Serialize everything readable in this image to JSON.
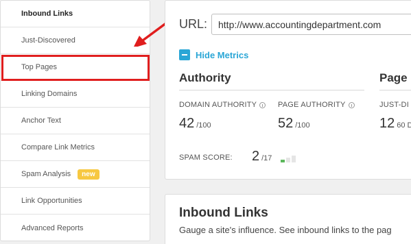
{
  "sidebar": {
    "items": [
      {
        "label": "Inbound Links"
      },
      {
        "label": "Just-Discovered"
      },
      {
        "label": "Top Pages"
      },
      {
        "label": "Linking Domains"
      },
      {
        "label": "Anchor Text"
      },
      {
        "label": "Compare Link Metrics"
      },
      {
        "label": "Spam Analysis",
        "badge": "new"
      },
      {
        "label": "Link Opportunities"
      },
      {
        "label": "Advanced Reports"
      }
    ]
  },
  "search": {
    "label": "URL:",
    "value": "http://www.accountingdepartment.com"
  },
  "metrics": {
    "toggle_label": "Hide Metrics",
    "authority_title": "Authority",
    "page_title": "Page",
    "domain_authority": {
      "label": "DOMAIN AUTHORITY",
      "value": "42",
      "max": "/100"
    },
    "page_authority": {
      "label": "PAGE AUTHORITY",
      "value": "52",
      "max": "/100"
    },
    "just_discovered": {
      "label": "JUST-DI",
      "value": "12",
      "unit": "60 D"
    },
    "spam_score": {
      "label": "SPAM SCORE:",
      "value": "2",
      "max": "/17",
      "active_bars": 1
    }
  },
  "inbound": {
    "title": "Inbound Links",
    "description": "Gauge a site's influence. See inbound links to the pag"
  },
  "colors": {
    "accent": "#2aa6d6",
    "highlight": "#e01e1e",
    "badge": "#f7c841",
    "spam_active": "#5cb85c"
  }
}
